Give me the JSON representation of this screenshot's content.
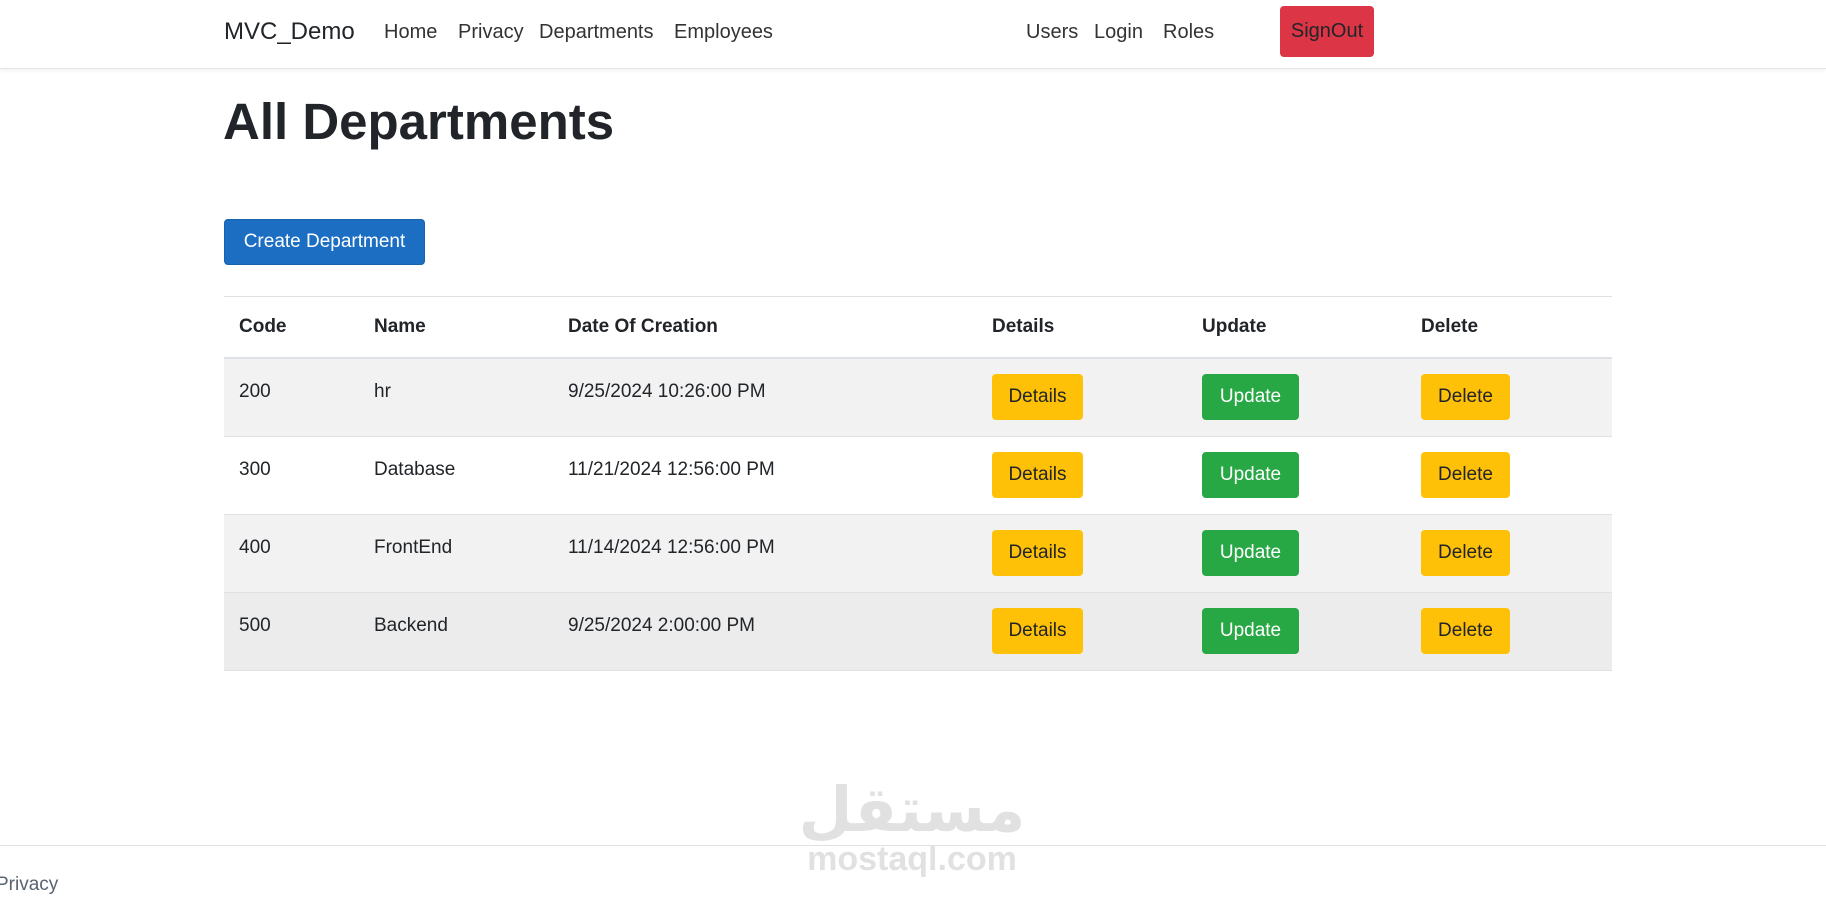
{
  "nav": {
    "brand": "MVC_Demo",
    "left_links": [
      "Home",
      "Privacy",
      "Departments",
      "Employees"
    ],
    "right_links": [
      "Users",
      "Login",
      "Roles"
    ],
    "signout": "SignOut",
    "signout_color": "#dc3545"
  },
  "main": {
    "title": "All Departments",
    "create_button": "Create Department",
    "create_button_color": "#1b6ec2",
    "table": {
      "headers": [
        "Code",
        "Name",
        "Date Of Creation",
        "Details",
        "Update",
        "Delete"
      ],
      "rows": [
        {
          "code": "200",
          "name": "hr",
          "date": "9/25/2024 10:26:00 PM",
          "details": "Details",
          "update": "Update",
          "delete": "Delete"
        },
        {
          "code": "300",
          "name": "Database",
          "date": "11/21/2024 12:56:00 PM",
          "details": "Details",
          "update": "Update",
          "delete": "Delete"
        },
        {
          "code": "400",
          "name": "FrontEnd",
          "date": "11/14/2024 12:56:00 PM",
          "details": "Details",
          "update": "Update",
          "delete": "Delete"
        },
        {
          "code": "500",
          "name": "Backend",
          "date": "9/25/2024 2:00:00 PM",
          "details": "Details",
          "update": "Update",
          "delete": "Delete"
        }
      ]
    }
  },
  "footer": {
    "privacy": "Privacy"
  },
  "watermark": {
    "logo_text": "مستقل",
    "site": "mostaql.com"
  }
}
